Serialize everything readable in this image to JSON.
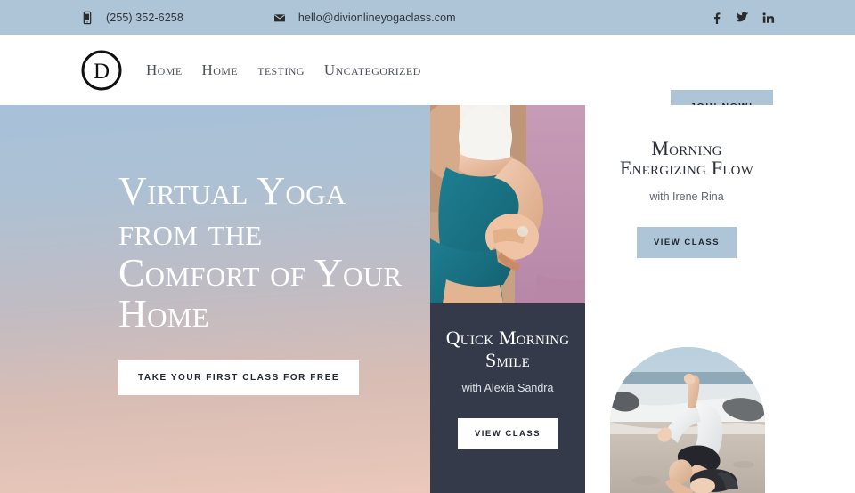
{
  "topbar": {
    "phone_icon": "mobile-phone-icon",
    "phone": "(255) 352-6258",
    "mail_icon": "envelope-icon",
    "email": "hello@divionlineyogaclass.com",
    "social": [
      {
        "name": "facebook-icon",
        "label": "f"
      },
      {
        "name": "twitter-icon",
        "label": "t"
      },
      {
        "name": "linkedin-icon",
        "label": "in"
      }
    ],
    "bg_color": "#aec5d8"
  },
  "nav": {
    "logo_letter": "D",
    "menu": [
      {
        "label": "Home"
      },
      {
        "label": "Home"
      },
      {
        "label": "testing"
      },
      {
        "label": "Uncategorized"
      }
    ],
    "cta_label": "JOIN NOW!",
    "cta_color": "#aec5d8"
  },
  "hero": {
    "heading": "Virtual Yoga from the Comfort of Your Home",
    "button_label": "TAKE YOUR FIRST CLASS FOR FREE",
    "gradient_from": "#a7c1d9",
    "gradient_to": "#ebc8bb"
  },
  "class_cards": [
    {
      "title": "Quick Morning Smile",
      "instructor": "with Alexia Sandra",
      "button_label": "VIEW CLASS",
      "bg_color": "#343a49",
      "button_color": "#ffffff",
      "photo_alt": "meditating-woman-photo"
    },
    {
      "title": "Morning Energizing Flow",
      "instructor": "with Irene Rina",
      "button_label": "VIEW CLASS",
      "bg_color": "#ffffff",
      "button_color": "#aec5d8",
      "photo_alt": "beach-headstand-photo"
    }
  ]
}
